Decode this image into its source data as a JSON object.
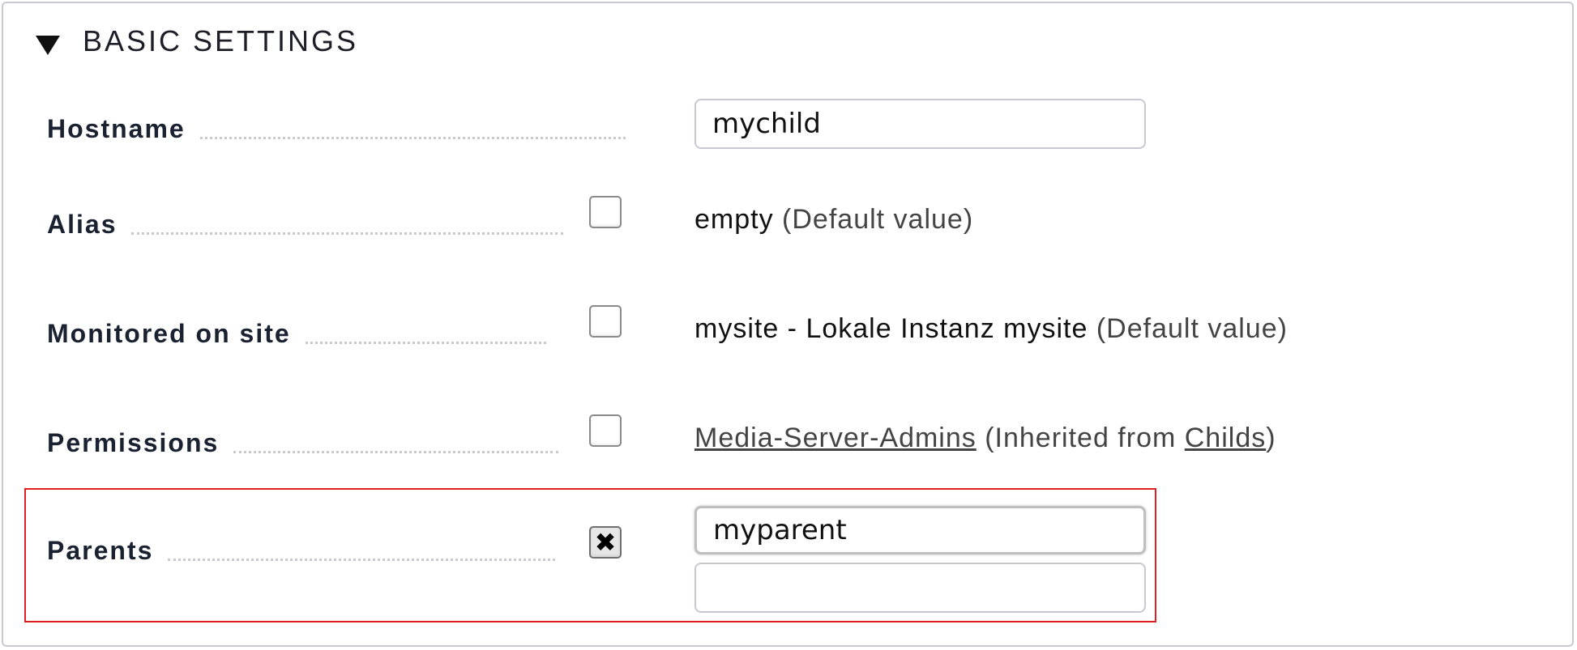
{
  "section": {
    "title": "BASIC SETTINGS",
    "toggle_icon": "triangle-down-icon"
  },
  "rows": {
    "hostname": {
      "label": "Hostname",
      "value": "mychild"
    },
    "alias": {
      "label": "Alias",
      "checked": false,
      "value": "empty",
      "note": "(Default value)"
    },
    "monitored_on_site": {
      "label": "Monitored on site",
      "checked": false,
      "value": "mysite - Lokale Instanz mysite",
      "note": "(Default value)"
    },
    "permissions": {
      "label": "Permissions",
      "checked": false,
      "link": "Media-Server-Admins",
      "note_prefix": "(Inherited from ",
      "note_link": "Childs",
      "note_suffix": ")"
    },
    "parents": {
      "label": "Parents",
      "checked": true,
      "check_icon": "x-mark-icon",
      "check_glyph": "✖",
      "values": [
        "myparent",
        ""
      ]
    }
  },
  "colors": {
    "highlight_border": "#e02020",
    "panel_border": "#c8c8d2",
    "label_text": "#1a2130"
  }
}
